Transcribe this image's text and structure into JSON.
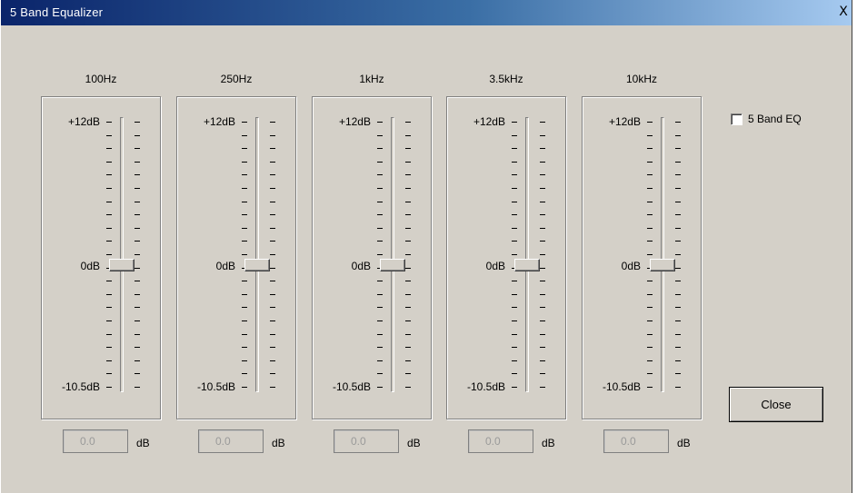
{
  "window": {
    "title": "5 Band Equalizer",
    "close_glyph": "X",
    "titlebar_gradient": [
      "#0a246a",
      "#3a6ea5",
      "#a6caf0"
    ],
    "face_color": "#d4d0c8"
  },
  "bands": [
    {
      "label": "100Hz",
      "top_label": "+12dB",
      "mid_label": "0dB",
      "bottom_label": "-10.5dB",
      "value": "0.0",
      "unit": "dB"
    },
    {
      "label": "250Hz",
      "top_label": "+12dB",
      "mid_label": "0dB",
      "bottom_label": "-10.5dB",
      "value": "0.0",
      "unit": "dB"
    },
    {
      "label": "1kHz",
      "top_label": "+12dB",
      "mid_label": "0dB",
      "bottom_label": "-10.5dB",
      "value": "0.0",
      "unit": "dB"
    },
    {
      "label": "3.5kHz",
      "top_label": "+12dB",
      "mid_label": "0dB",
      "bottom_label": "-10.5dB",
      "value": "0.0",
      "unit": "dB"
    },
    {
      "label": "10kHz",
      "top_label": "+12dB",
      "mid_label": "0dB",
      "bottom_label": "-10.5dB",
      "value": "0.0",
      "unit": "dB"
    }
  ],
  "enable_checkbox": {
    "label": "5 Band EQ",
    "checked": false
  },
  "close_button": {
    "label": "Close"
  }
}
